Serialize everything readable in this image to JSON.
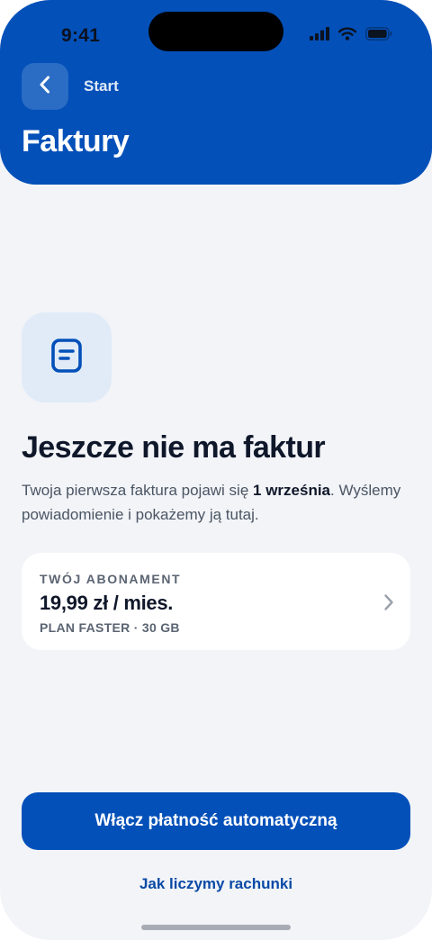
{
  "status_bar": {
    "time": "9:41"
  },
  "header": {
    "back_label": "Start",
    "title": "Faktury"
  },
  "empty_state": {
    "icon": "document-icon",
    "title": "Jeszcze nie ma faktur",
    "desc_prefix": "Twoja pierwsza faktura pojawi się ",
    "desc_date": "1 września",
    "desc_suffix": ". Wyślemy powiadomienie i pokażemy ją tutaj."
  },
  "subscription": {
    "label": "TWÓJ ABONAMENT",
    "price": "19,99 zł / mies.",
    "plan": "PLAN FASTER · 30 GB"
  },
  "actions": {
    "primary_label": "Włącz płatność automatyczną",
    "secondary_label": "Jak liczymy rachunki"
  },
  "colors": {
    "brand": "#0350b9",
    "background": "#f2f4f8",
    "icon_tile": "#e1ebf8"
  }
}
